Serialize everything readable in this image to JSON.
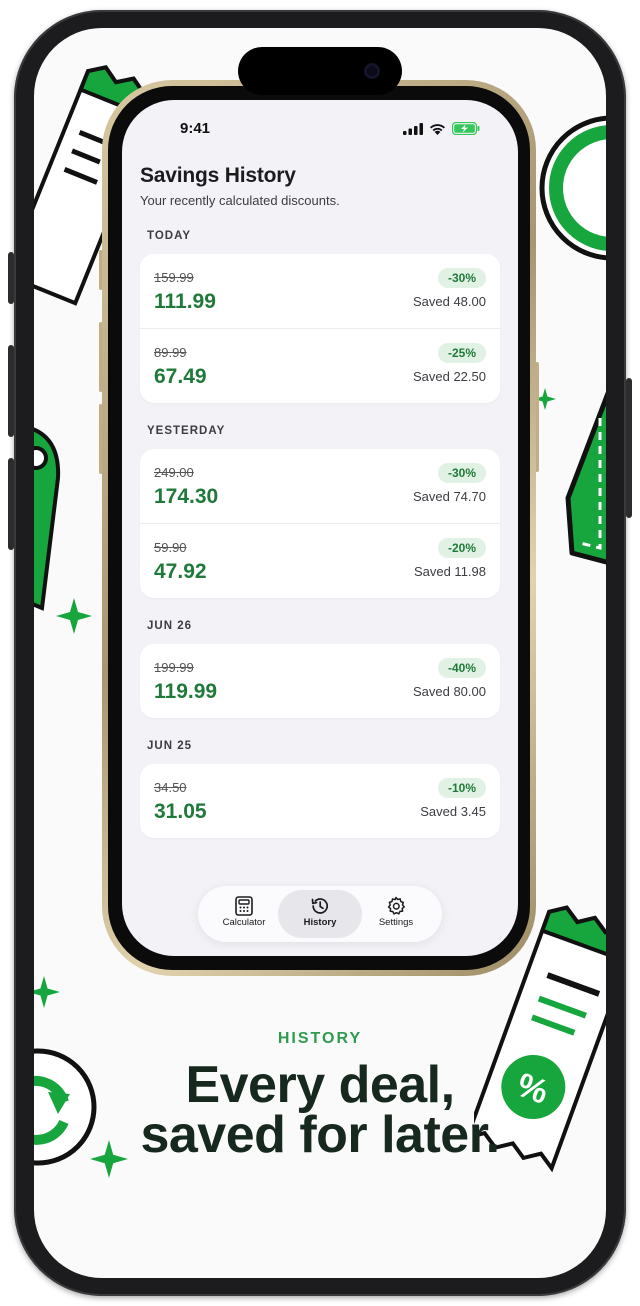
{
  "status": {
    "time": "9:41"
  },
  "header": {
    "title": "Savings History",
    "subtitle": "Your recently calculated discounts."
  },
  "groups": [
    {
      "label": "TODAY",
      "entries": [
        {
          "original": "159.99",
          "final": "111.99",
          "discount": "-30%",
          "saved": "Saved 48.00"
        },
        {
          "original": "89.99",
          "final": "67.49",
          "discount": "-25%",
          "saved": "Saved 22.50"
        }
      ]
    },
    {
      "label": "YESTERDAY",
      "entries": [
        {
          "original": "249.00",
          "final": "174.30",
          "discount": "-30%",
          "saved": "Saved 74.70"
        },
        {
          "original": "59.90",
          "final": "47.92",
          "discount": "-20%",
          "saved": "Saved 11.98"
        }
      ]
    },
    {
      "label": "JUN 26",
      "entries": [
        {
          "original": "199.99",
          "final": "119.99",
          "discount": "-40%",
          "saved": "Saved 80.00"
        }
      ]
    },
    {
      "label": "JUN 25",
      "entries": [
        {
          "original": "34.50",
          "final": "31.05",
          "discount": "-10%",
          "saved": "Saved 3.45"
        }
      ]
    }
  ],
  "tabbar": {
    "tabs": [
      {
        "label": "Calculator",
        "icon": "calculator-icon"
      },
      {
        "label": "History",
        "icon": "history-icon",
        "active": true
      },
      {
        "label": "Settings",
        "icon": "gear-icon"
      }
    ]
  },
  "caption": {
    "label": "HISTORY",
    "headline_line1": "Every deal,",
    "headline_line2": "saved for later."
  },
  "colors": {
    "accent": "#1f7a3a",
    "badge_bg": "#e1f2e4",
    "deco_green": "#17a53d",
    "headline": "#17291e"
  }
}
